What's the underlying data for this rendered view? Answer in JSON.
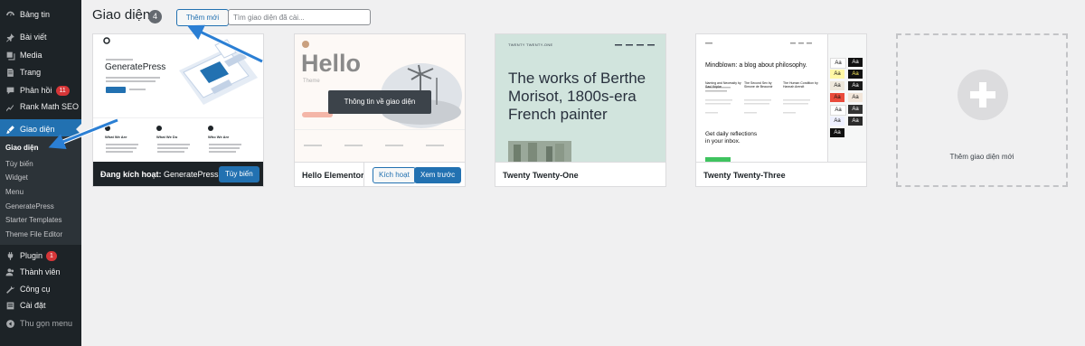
{
  "sidebar": {
    "items": [
      {
        "label": "Bảng tin",
        "icon": "dashboard-icon"
      },
      {
        "label": "Bài viết",
        "icon": "pin-icon"
      },
      {
        "label": "Media",
        "icon": "media-icon"
      },
      {
        "label": "Trang",
        "icon": "page-icon"
      },
      {
        "label": "Phản hồi",
        "icon": "comment-icon",
        "badge": "11"
      },
      {
        "label": "Rank Math SEO",
        "icon": "rank-math-icon"
      },
      {
        "label": "Giao diện",
        "icon": "appearance-icon"
      },
      {
        "label": "Plugin",
        "icon": "plugin-icon",
        "badge": "1"
      },
      {
        "label": "Thành viên",
        "icon": "users-icon"
      },
      {
        "label": "Công cụ",
        "icon": "tools-icon"
      },
      {
        "label": "Cài đặt",
        "icon": "settings-icon"
      },
      {
        "label": "Thu gọn menu",
        "icon": "collapse-icon"
      }
    ],
    "submenu": [
      "Giao diện",
      "Tùy biến",
      "Widget",
      "Menu",
      "GeneratePress",
      "Starter Templates",
      "Theme File Editor"
    ]
  },
  "header": {
    "title": "Giao diện",
    "count": "4",
    "add_new": "Thêm mới",
    "search_placeholder": "Tìm giao diện đã cài..."
  },
  "themes": [
    {
      "name_prefix": "Đang kích hoạt:",
      "name": "GeneratePress",
      "button": "Tùy biến",
      "preview": {
        "brand": "GeneratePress",
        "features": [
          "What We Are",
          "What We Do",
          "Who We Are"
        ]
      }
    },
    {
      "name": "Hello Elementor",
      "buttons": [
        "Kích hoạt",
        "Xem trước"
      ],
      "preview": {
        "headline": "Hello",
        "subline": "Theme",
        "overlay": "Thông tin về giao diện"
      }
    },
    {
      "name": "Twenty Twenty-One",
      "preview": {
        "site": "TWENTY TWENTY-ONE",
        "headline": "The works of Berthe Morisot, 1800s-era French painter"
      }
    },
    {
      "name": "Twenty Twenty-Three",
      "preview": {
        "headline": "Mindblown: a blog about philosophy.",
        "posts": [
          "Naming and Necessity by Saul Kripke",
          "The Second Sex by Simone de Beauvoir",
          "The Human Condition by Hannah Arendt"
        ],
        "cta": "Get daily reflections in your inbox.",
        "swatch": "Aa"
      }
    }
  ],
  "add_theme": {
    "label": "Thêm giao diện mới"
  },
  "colors": {
    "admin_bg": "#1d2327",
    "accent": "#2271b1",
    "badge": "#d63638",
    "arrow": "#2b7fd4"
  }
}
